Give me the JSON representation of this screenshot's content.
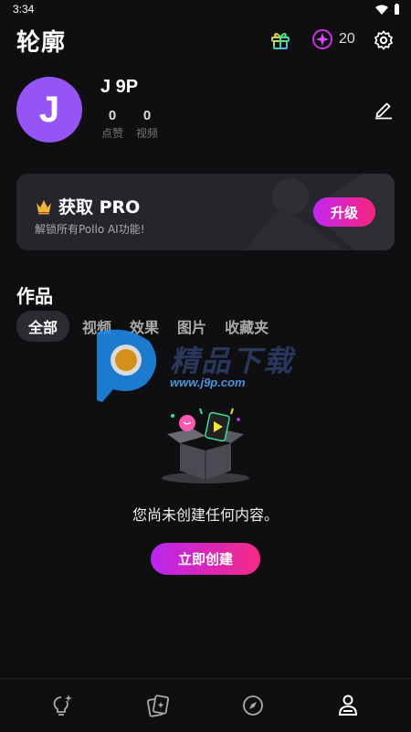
{
  "status": {
    "time": "3:34"
  },
  "header": {
    "title": "轮廓",
    "credits": "20"
  },
  "profile": {
    "avatar_letter": "J",
    "username": "J 9P",
    "likes_value": "0",
    "likes_label": "点赞",
    "videos_value": "0",
    "videos_label": "视频"
  },
  "pro_card": {
    "title": "获取 PRO",
    "subtitle": "解锁所有Pollo AI功能!",
    "button": "升级"
  },
  "works": {
    "title": "作品",
    "tabs": [
      "全部",
      "视频",
      "效果",
      "图片",
      "收藏夹"
    ]
  },
  "watermark": {
    "text": "精品下载",
    "url": "www.j9p.com"
  },
  "empty_state": {
    "message": "您尚未创建任何内容。",
    "button": "立即创建"
  },
  "bottom_nav": {
    "items": [
      "lightbulb-sparkle-icon",
      "cards-icon",
      "compass-icon",
      "profile-icon"
    ]
  },
  "colors": {
    "background": "#0f0f12",
    "avatar": "#9455f4",
    "accent_start": "#c128f2",
    "accent_end": "#f7237d"
  }
}
